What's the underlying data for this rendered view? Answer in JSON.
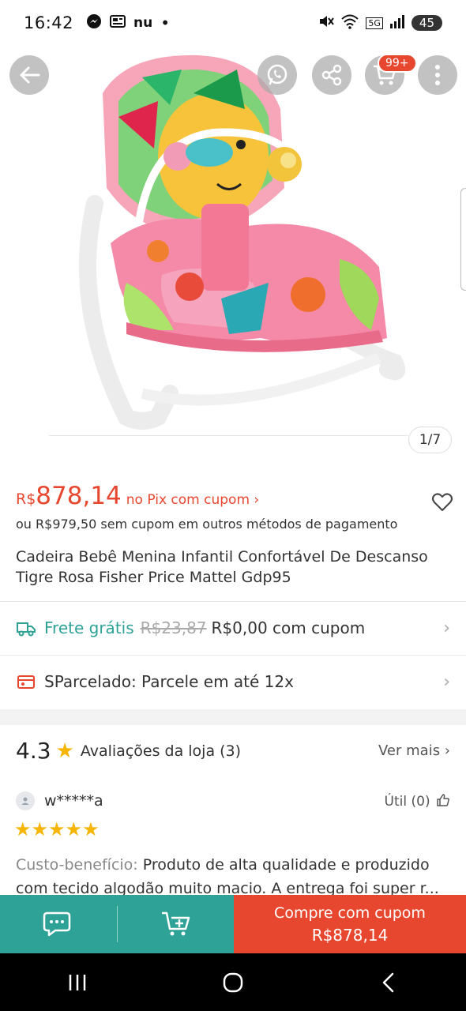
{
  "status_bar": {
    "time": "16:42",
    "app_icons": [
      "messenger-icon",
      "news-icon",
      "nu-icon"
    ],
    "nu_text": "nu",
    "dot": "•",
    "network_label": "5G",
    "battery": "45"
  },
  "gallery": {
    "counter": "1/7",
    "cart_badge": "99+"
  },
  "price": {
    "currency": "R$",
    "value": "878,14",
    "pix_label": "no Pix com cupom ›",
    "alternative": "ou R$979,50 sem cupom em outros métodos de pagamento"
  },
  "product": {
    "title": "Cadeira Bebê Menina Infantil Confortável De Descanso Tigre Rosa Fisher Price Mattel Gdp95"
  },
  "shipping": {
    "label": "Frete grátis",
    "old_price": "R$23,87",
    "new_price": "R$0,00 com cupom"
  },
  "installments": {
    "label": "SParcelado: Parcele em até 12x"
  },
  "reviews": {
    "score": "4.3",
    "label": "Avaliações da loja (3)",
    "see_more": "Ver mais ›",
    "user": "w*****a",
    "useful": "Útil (0)",
    "stars": "★★★★★",
    "category": "Custo-benefício:",
    "text": "Produto de alta qualidade e produzido com tecido algodão muito macio. A entrega foi super r..."
  },
  "actions": {
    "buy_label": "Compre com cupom",
    "buy_price": "R$878,14"
  },
  "colors": {
    "accent_orange": "#e8472f",
    "accent_teal": "#2ea296",
    "star": "#f6b500"
  }
}
